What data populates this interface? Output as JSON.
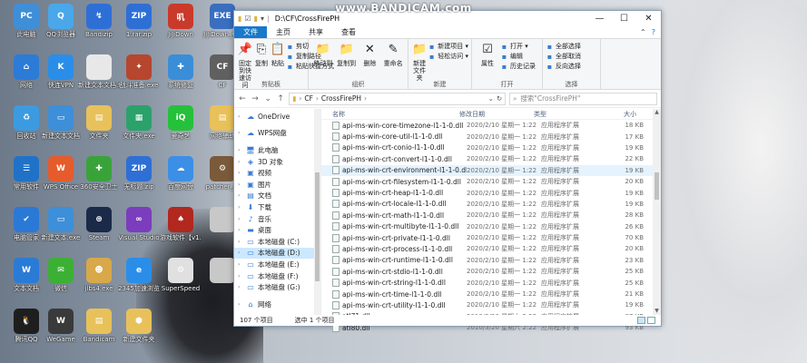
{
  "watermark": "www.BANDICAM.com",
  "desktop_icons": [
    {
      "label": "此电脑",
      "color": "#3f8fd8",
      "glyph": "PC"
    },
    {
      "label": "QQ浏览器",
      "color": "#4aa7ea",
      "glyph": "Q"
    },
    {
      "label": "Bandizip",
      "color": "#2e6fd6",
      "glyph": "↯"
    },
    {
      "label": "1.rar.zip",
      "color": "#2e6fd6",
      "glyph": "ZIP"
    },
    {
      "label": "JiJiDown",
      "color": "#c93a2b",
      "glyph": "叽"
    },
    {
      "label": "JiJiDown_v...",
      "color": "#3a6ebf",
      "glyph": "EXE"
    },
    {
      "label": "网络",
      "color": "#2c7bd6",
      "glyph": "⌂"
    },
    {
      "label": "快连VPN",
      "color": "#2a8ee8",
      "glyph": "K"
    },
    {
      "label": "新建文本文档.txt",
      "color": "#e8e8e8",
      "glyph": ""
    },
    {
      "label": "战斗准备.exe",
      "color": "#b6462d",
      "glyph": "✦"
    },
    {
      "label": "系统修复",
      "color": "#3a8ed8",
      "glyph": "✚"
    },
    {
      "label": "CF",
      "color": "#606060",
      "glyph": "CF"
    },
    {
      "label": "回收站",
      "color": "#3c9be0",
      "glyph": "♻"
    },
    {
      "label": "新建文本文档",
      "color": "#3c8fd8",
      "glyph": "▭"
    },
    {
      "label": "文件夹",
      "color": "#e8c15a",
      "glyph": "▤"
    },
    {
      "label": "文件夹.exe",
      "color": "#2aa26a",
      "glyph": "▦"
    },
    {
      "label": "爱奇艺",
      "color": "#25c13b",
      "glyph": "iQ"
    },
    {
      "label": "网络辅助",
      "color": "#e8c15a",
      "glyph": "▤"
    },
    {
      "label": "常用软件",
      "color": "#1f72c8",
      "glyph": "☰"
    },
    {
      "label": "WPS Office",
      "color": "#e65b2b",
      "glyph": "W"
    },
    {
      "label": "360安全卫士",
      "color": "#39a33a",
      "glyph": "✚"
    },
    {
      "label": "无标题.zip",
      "color": "#2e6fd6",
      "glyph": "ZIP"
    },
    {
      "label": "百度网盘",
      "color": "#3b8fe6",
      "glyph": "☁"
    },
    {
      "label": "patcher_cf",
      "color": "#7a5a3a",
      "glyph": "⚙"
    },
    {
      "label": "电脑管家",
      "color": "#2a79d6",
      "glyph": "✔"
    },
    {
      "label": "新建文本.exe",
      "color": "#3c8fd8",
      "glyph": "▭"
    },
    {
      "label": "Steam",
      "color": "#1b2a48",
      "glyph": "⊛"
    },
    {
      "label": "Visual Studio",
      "color": "#7b3dbd",
      "glyph": "∞"
    },
    {
      "label": "游戏软件【v1.2】.exe",
      "color": "#b2281f",
      "glyph": "♠"
    },
    {
      "label": "",
      "color": "#c8c8c8",
      "glyph": ""
    },
    {
      "label": "文本文档",
      "color": "#2a7bd6",
      "glyph": "W"
    },
    {
      "label": "微信",
      "color": "#3cb034",
      "glyph": "✉"
    },
    {
      "label": "jlbs4.exe",
      "color": "#d8a84a",
      "glyph": "☻"
    },
    {
      "label": "2345加速浏览器",
      "color": "#2a8ee8",
      "glyph": "e"
    },
    {
      "label": "SuperSpeed",
      "color": "#e0e0e0",
      "glyph": "⚙"
    },
    {
      "label": "",
      "color": "#c8c8c8",
      "glyph": ""
    },
    {
      "label": "腾讯QQ",
      "color": "#1e1e1e",
      "glyph": "🐧"
    },
    {
      "label": "WeGame",
      "color": "#3a3a3a",
      "glyph": "W"
    },
    {
      "label": "Bandicam",
      "color": "#e8c15a",
      "glyph": "▤"
    },
    {
      "label": "新建文件夹",
      "color": "#e8c15a",
      "glyph": "⬢"
    }
  ],
  "window": {
    "title": "D:\\CF\\CrossFirePH",
    "tabs": [
      "文件",
      "主页",
      "共享",
      "查看"
    ],
    "ribbon": {
      "groups": [
        {
          "name": "剪贴板",
          "big": [
            {
              "label": "固定到快速访问",
              "icon": "📌"
            },
            {
              "label": "复制",
              "icon": "⎘"
            },
            {
              "label": "粘贴",
              "icon": "📋"
            }
          ],
          "small": [
            "剪切",
            "复制路径",
            "粘贴快捷方式"
          ]
        },
        {
          "name": "组织",
          "big": [
            {
              "label": "移动到",
              "icon": "📁"
            },
            {
              "label": "复制到",
              "icon": "📁"
            },
            {
              "label": "删除",
              "icon": "✕"
            },
            {
              "label": "重命名",
              "icon": "✎"
            }
          ],
          "small": []
        },
        {
          "name": "新建",
          "big": [
            {
              "label": "新建文件夹",
              "icon": "📁"
            }
          ],
          "small": [
            "新建项目 ▾",
            "轻松访问 ▾"
          ]
        },
        {
          "name": "打开",
          "big": [
            {
              "label": "属性",
              "icon": "☑"
            }
          ],
          "small": [
            "打开 ▾",
            "编辑",
            "历史记录"
          ]
        },
        {
          "name": "选择",
          "big": [],
          "small": [
            "全部选择",
            "全部取消",
            "反向选择"
          ]
        }
      ]
    },
    "address": {
      "segments": [
        "CF",
        "CrossFirePH"
      ],
      "search_placeholder": "搜索\"CrossFirePH\""
    },
    "nav": [
      {
        "label": "OneDrive",
        "icon": "☁",
        "gap": false
      },
      {
        "label": "WPS网盘",
        "icon": "☁",
        "gap": true
      },
      {
        "label": "此电脑",
        "icon": "🖥",
        "gap": true
      },
      {
        "label": "3D 对象",
        "icon": "◈",
        "gap": false
      },
      {
        "label": "视频",
        "icon": "▣",
        "gap": false
      },
      {
        "label": "图片",
        "icon": "▣",
        "gap": false
      },
      {
        "label": "文档",
        "icon": "▤",
        "gap": false
      },
      {
        "label": "下载",
        "icon": "⬇",
        "gap": false
      },
      {
        "label": "音乐",
        "icon": "♪",
        "gap": false
      },
      {
        "label": "桌面",
        "icon": "▬",
        "gap": false
      },
      {
        "label": "本地磁盘 (C:)",
        "icon": "▭",
        "gap": false
      },
      {
        "label": "本地磁盘 (D:)",
        "icon": "▭",
        "gap": false,
        "selected": true
      },
      {
        "label": "本地磁盘 (E:)",
        "icon": "▭",
        "gap": false
      },
      {
        "label": "本地磁盘 (F:)",
        "icon": "▭",
        "gap": false
      },
      {
        "label": "本地磁盘 (G:)",
        "icon": "▭",
        "gap": false
      },
      {
        "label": "网络",
        "icon": "⌂",
        "gap": true
      }
    ],
    "columns": {
      "name": "名称",
      "date": "修改日期",
      "type": "类型",
      "size": "大小"
    },
    "files": [
      {
        "name": "api-ms-win-core-timezone-l1-1-0.dll",
        "date": "2020/2/10 星期一 1:22",
        "type": "应用程序扩展",
        "size": "18 KB"
      },
      {
        "name": "api-ms-win-core-util-l1-1-0.dll",
        "date": "2020/2/10 星期一 1:22",
        "type": "应用程序扩展",
        "size": "17 KB"
      },
      {
        "name": "api-ms-win-crt-conio-l1-1-0.dll",
        "date": "2020/2/10 星期一 1:22",
        "type": "应用程序扩展",
        "size": "19 KB"
      },
      {
        "name": "api-ms-win-crt-convert-l1-1-0.dll",
        "date": "2020/2/10 星期一 1:22",
        "type": "应用程序扩展",
        "size": "22 KB"
      },
      {
        "name": "api-ms-win-crt-environment-l1-1-0.dll",
        "date": "2020/2/10 星期一 1:22",
        "type": "应用程序扩展",
        "size": "19 KB",
        "highlight": true
      },
      {
        "name": "api-ms-win-crt-filesystem-l1-1-0.dll",
        "date": "2020/2/10 星期一 1:22",
        "type": "应用程序扩展",
        "size": "20 KB"
      },
      {
        "name": "api-ms-win-crt-heap-l1-1-0.dll",
        "date": "2020/2/10 星期一 1:22",
        "type": "应用程序扩展",
        "size": "19 KB"
      },
      {
        "name": "api-ms-win-crt-locale-l1-1-0.dll",
        "date": "2020/2/10 星期一 1:22",
        "type": "应用程序扩展",
        "size": "19 KB"
      },
      {
        "name": "api-ms-win-crt-math-l1-1-0.dll",
        "date": "2020/2/10 星期一 1:22",
        "type": "应用程序扩展",
        "size": "28 KB"
      },
      {
        "name": "api-ms-win-crt-multibyte-l1-1-0.dll",
        "date": "2020/2/10 星期一 1:22",
        "type": "应用程序扩展",
        "size": "26 KB"
      },
      {
        "name": "api-ms-win-crt-private-l1-1-0.dll",
        "date": "2020/2/10 星期一 1:22",
        "type": "应用程序扩展",
        "size": "70 KB"
      },
      {
        "name": "api-ms-win-crt-process-l1-1-0.dll",
        "date": "2020/2/10 星期一 1:22",
        "type": "应用程序扩展",
        "size": "20 KB"
      },
      {
        "name": "api-ms-win-crt-runtime-l1-1-0.dll",
        "date": "2020/2/10 星期一 1:22",
        "type": "应用程序扩展",
        "size": "23 KB"
      },
      {
        "name": "api-ms-win-crt-stdio-l1-1-0.dll",
        "date": "2020/2/10 星期一 1:22",
        "type": "应用程序扩展",
        "size": "25 KB"
      },
      {
        "name": "api-ms-win-crt-string-l1-1-0.dll",
        "date": "2020/2/10 星期一 1:22",
        "type": "应用程序扩展",
        "size": "25 KB"
      },
      {
        "name": "api-ms-win-crt-time-l1-1-0.dll",
        "date": "2020/2/10 星期一 1:22",
        "type": "应用程序扩展",
        "size": "21 KB"
      },
      {
        "name": "api-ms-win-crt-utility-l1-1-0.dll",
        "date": "2020/2/10 星期一 1:22",
        "type": "应用程序扩展",
        "size": "19 KB"
      },
      {
        "name": "atl71.dll",
        "date": "2010/3/20 星期六 2:22",
        "type": "应用程序扩展",
        "size": "87 KB"
      },
      {
        "name": "atl80.dll",
        "date": "2010/3/20 星期六 2:22",
        "type": "应用程序扩展",
        "size": "93 KB"
      }
    ],
    "status": {
      "count": "107 个项目",
      "selected": "选中 1 个项目"
    }
  }
}
